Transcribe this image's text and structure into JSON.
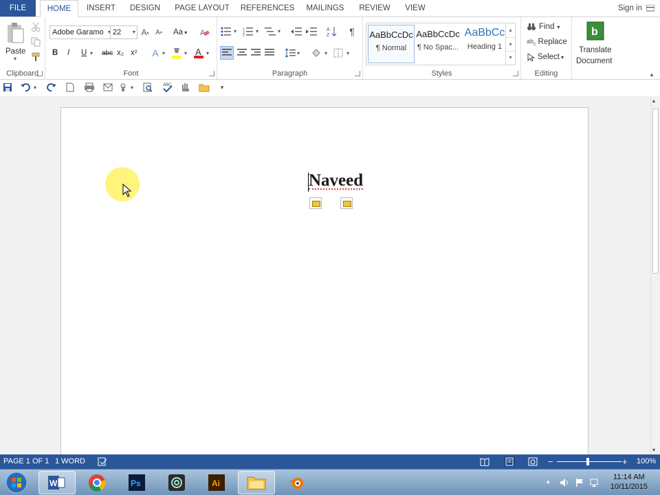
{
  "ribbon_tabs": {
    "file": "FILE",
    "home": "HOME",
    "insert": "INSERT",
    "design": "DESIGN",
    "page_layout": "PAGE LAYOUT",
    "references": "REFERENCES",
    "mailings": "MAILINGS",
    "review": "REVIEW",
    "view": "VIEW",
    "sign_in": "Sign in"
  },
  "clipboard": {
    "paste_label": "Paste",
    "group_label": "Clipboard"
  },
  "font": {
    "family": "Adobe Garamo",
    "size": "22",
    "change_case": "Aa",
    "bold": "B",
    "italic": "I",
    "underline": "U",
    "strikethrough": "abc",
    "subscript": "x₂",
    "superscript": "x²",
    "group_label": "Font"
  },
  "paragraph": {
    "group_label": "Paragraph"
  },
  "styles": {
    "items": [
      {
        "preview": "AaBbCcDc",
        "name": "¶ Normal"
      },
      {
        "preview": "AaBbCcDc",
        "name": "¶ No Spac..."
      },
      {
        "preview": "AaBbCc",
        "name": "Heading 1"
      }
    ],
    "group_label": "Styles"
  },
  "editing": {
    "find": "Find",
    "replace": "Replace",
    "select": "Select",
    "group_label": "Editing"
  },
  "translate": {
    "line1": "Translate",
    "line2": "Document"
  },
  "document": {
    "text": "Naveed"
  },
  "status_bar": {
    "page": "PAGE 1 OF 1",
    "words": "1 WORD",
    "zoom": "100%"
  },
  "taskbar": {
    "time": "11:14 AM",
    "date": "10/11/2015"
  },
  "colors": {
    "accent": "#2b579a",
    "font_color_bar": "#e02020",
    "highlight_bar": "#ffff00"
  }
}
